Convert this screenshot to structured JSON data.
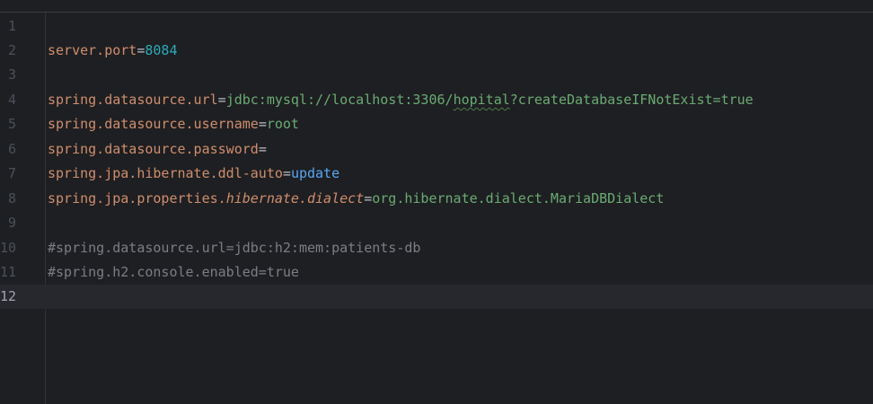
{
  "editor": {
    "lines": [
      {
        "number": "1"
      },
      {
        "number": "2",
        "key": "server.port",
        "eq": "=",
        "value": "8084"
      },
      {
        "number": "3"
      },
      {
        "number": "4",
        "key": "spring.datasource.url",
        "eq": "=",
        "value_a": "jdbc:mysql://localhost:3306/",
        "value_typo": "hopital",
        "value_b": "?createDatabaseIFNotExist=true"
      },
      {
        "number": "5",
        "key": "spring.datasource.username",
        "eq": "=",
        "value": "root"
      },
      {
        "number": "6",
        "key": "spring.datasource.password",
        "eq": "="
      },
      {
        "number": "7",
        "key": "spring.jpa.hibernate.ddl-auto",
        "eq": "=",
        "value": "update"
      },
      {
        "number": "8",
        "key_a": "spring.jpa.properties.",
        "key_b": "hibernate.dialect",
        "eq": "=",
        "value": "org.hibernate.dialect.MariaDBDialect"
      },
      {
        "number": "9"
      },
      {
        "number": "10",
        "comment": "#spring.datasource.url=jdbc:h2:mem:patients-db"
      },
      {
        "number": "11",
        "comment": "#spring.h2.console.enabled=true"
      },
      {
        "number": "12"
      }
    ]
  },
  "colors": {
    "background": "#1e1f22",
    "key": "#cf8e6d",
    "number_value": "#2aacb8",
    "string_value": "#6aab73",
    "keyword_value": "#56a8f5",
    "comment": "#7a7e85"
  }
}
